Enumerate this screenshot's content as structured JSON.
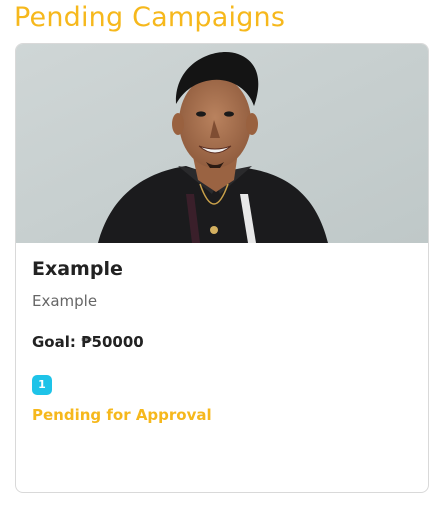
{
  "header": {
    "title": "Pending Campaigns"
  },
  "campaign": {
    "title": "Example",
    "description": "Example",
    "goal": "Goal: ₱50000",
    "badge_count": "1",
    "status": "Pending for Approval"
  },
  "colors": {
    "accent": "#f6b81c",
    "badge": "#1ec3e8",
    "text": "#222222",
    "muted": "#666666"
  }
}
